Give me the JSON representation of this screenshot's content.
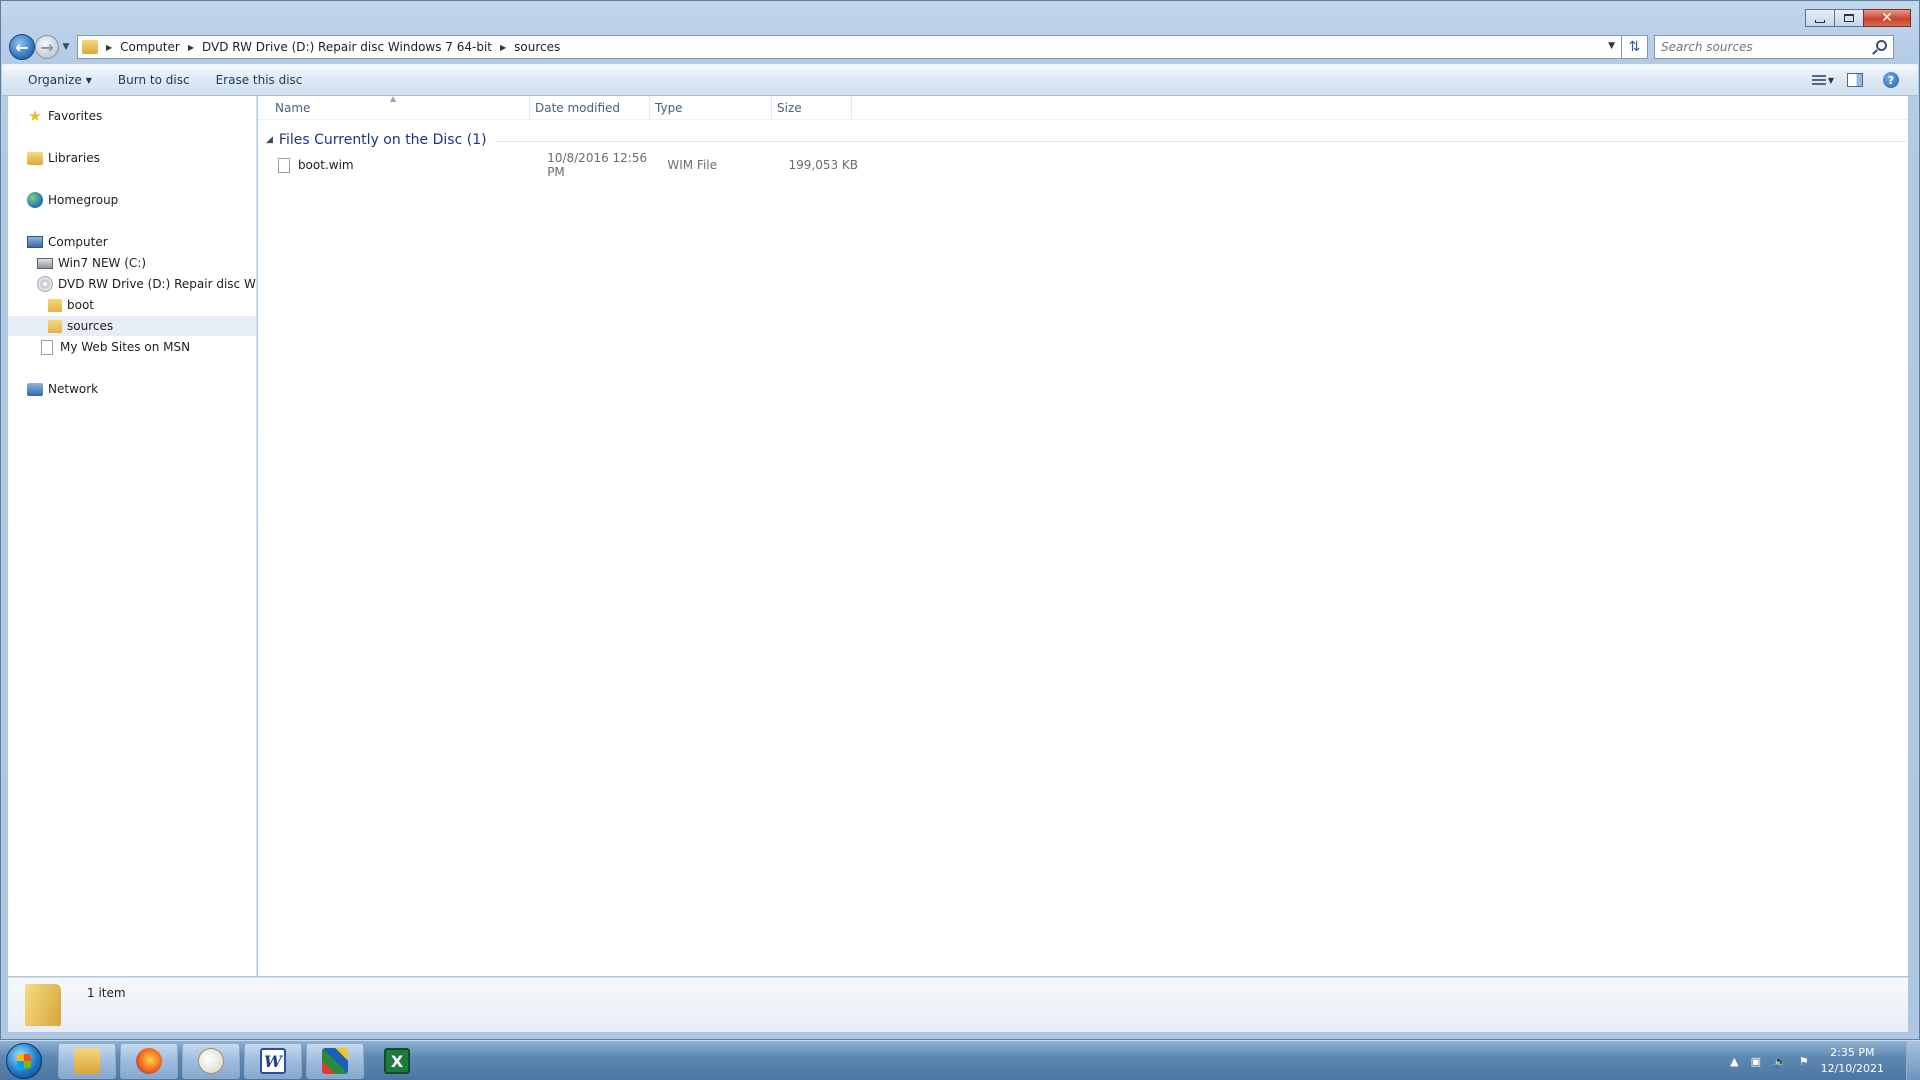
{
  "window": {
    "caption_close_glyph": "✕"
  },
  "navigation": {
    "back_icon": "back-arrow-icon",
    "forward_icon": "forward-arrow-icon",
    "breadcrumbs": [
      "Computer",
      "DVD RW Drive (D:) Repair disc Windows 7 64-bit",
      "sources"
    ],
    "search_placeholder": "Search sources"
  },
  "command_bar": {
    "organize_label": "Organize",
    "burn_label": "Burn to disc",
    "erase_label": "Erase this disc"
  },
  "nav_pane": {
    "favorites": "Favorites",
    "libraries": "Libraries",
    "homegroup": "Homegroup",
    "computer": "Computer",
    "drive_c": "Win7 NEW (C:)",
    "drive_d": "DVD RW Drive (D:) Repair disc Windows 7 64-bit",
    "folder_boot": "boot",
    "folder_sources": "sources",
    "msn": "My Web Sites on MSN",
    "network": "Network"
  },
  "file_list": {
    "columns": {
      "name": "Name",
      "date": "Date modified",
      "type": "Type",
      "size": "Size"
    },
    "group_title": "Files Currently on the Disc (1)",
    "files": [
      {
        "name": "boot.wim",
        "date": "10/8/2016 12:56 PM",
        "type": "WIM File",
        "size": "199,053 KB"
      }
    ]
  },
  "details": {
    "count": "1 item"
  },
  "taskbar": {
    "word_glyph": "W",
    "excel_glyph": "X",
    "time": "2:35 PM",
    "date": "12/10/2021"
  },
  "colors": {
    "group_title": "#1e3287",
    "window_frame": "#b4cbe4",
    "taskbar": "#5f88b2",
    "selected_tree_item": "#e6edf5"
  }
}
